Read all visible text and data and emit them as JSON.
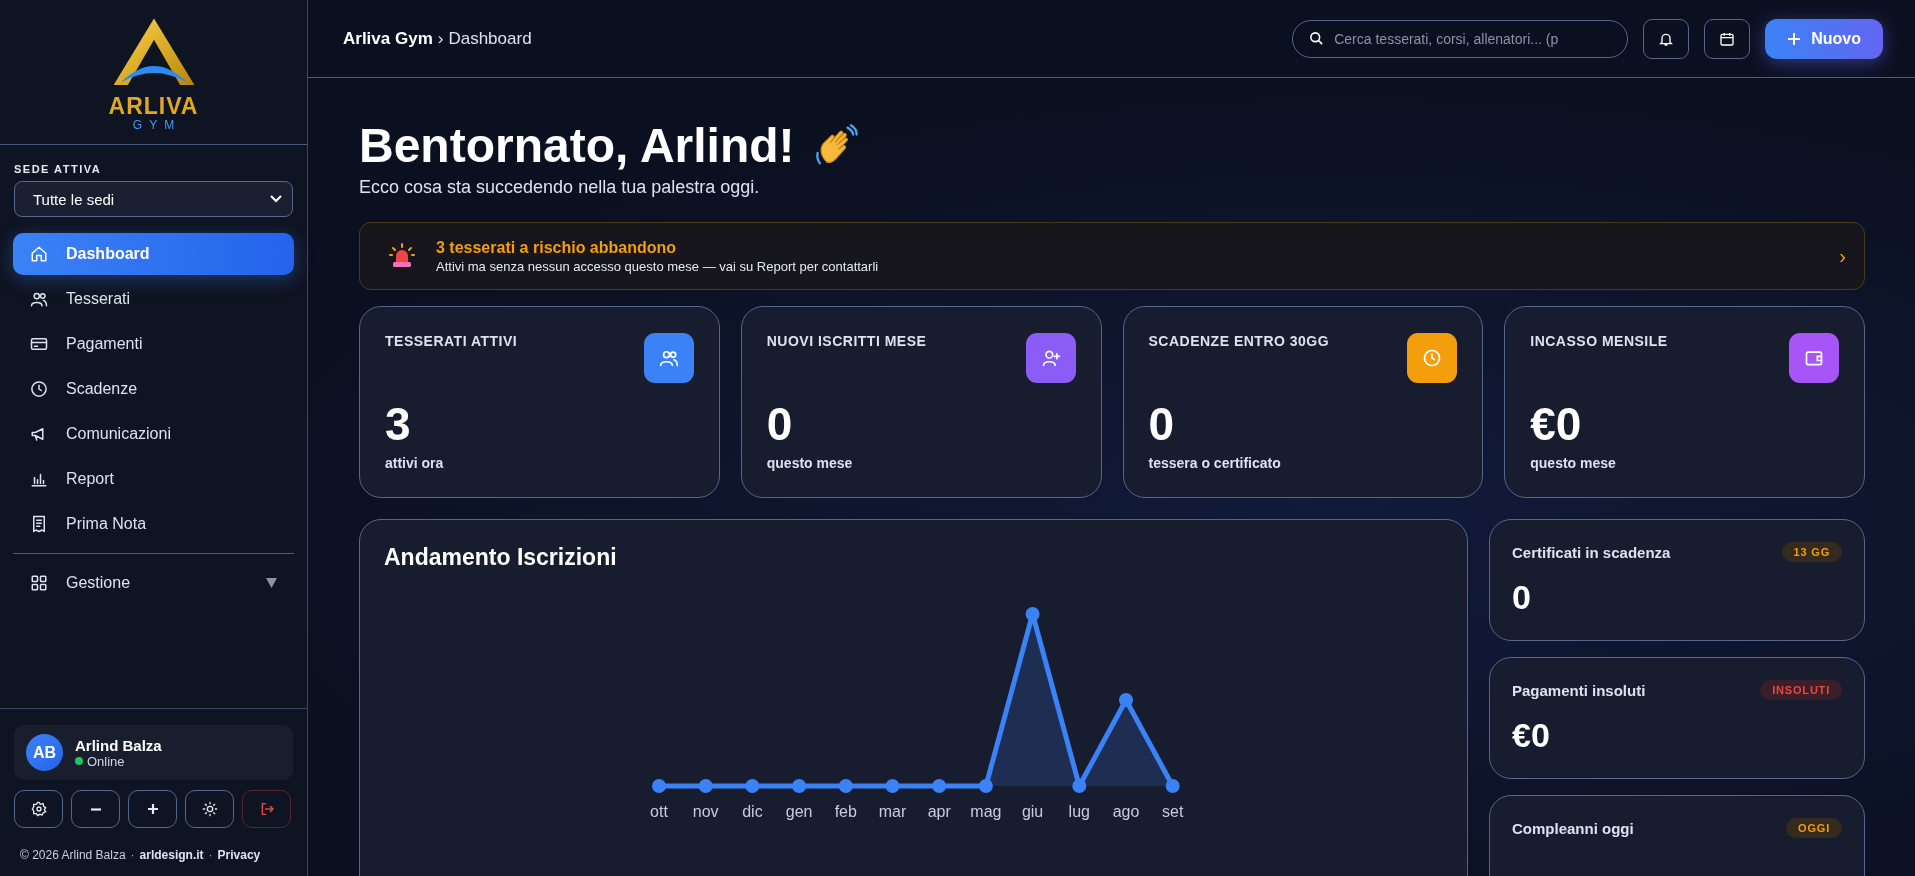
{
  "header": {
    "breadcrumb_root": "Arliva Gym",
    "breadcrumb_separator": "›",
    "breadcrumb_current": "Dashboard",
    "search": {
      "placeholder": "Cerca tesserati, corsi, allenatori... (p"
    },
    "new_button": {
      "label": "Nuovo"
    }
  },
  "sidebar": {
    "logo": {
      "name": "ARLIVA",
      "sub": "GYM"
    },
    "site_label": "SEDE ATTIVA",
    "site_select": {
      "value": "Tutte le sedi"
    },
    "nav": [
      {
        "label": "Dashboard",
        "selected": true
      },
      {
        "label": "Tesserati",
        "selected": false
      },
      {
        "label": "Pagamenti",
        "selected": false
      },
      {
        "label": "Scadenze",
        "selected": false
      },
      {
        "label": "Comunicazioni",
        "selected": false
      },
      {
        "label": "Report",
        "selected": false
      },
      {
        "label": "Prima Nota",
        "selected": false
      }
    ],
    "group": {
      "label": "Gestione",
      "expanded": false
    },
    "user": {
      "initials": "AB",
      "name": "Arlind Balza",
      "status": "Online",
      "online": true
    },
    "footer": {
      "copyright": "© 2026 Arlind Balza",
      "separator": "·",
      "link": "arldesign.it",
      "separator_2": "·",
      "privacy": "Privacy"
    }
  },
  "welcome": {
    "title": "Bentornato, Arlind!",
    "subtitle": "Ecco cosa sta succedendo nella tua palestra oggi."
  },
  "alert": {
    "title": "3 tesserati a rischio abbandono",
    "text": "Attivi ma senza nessun accesso questo mese — vai su Report per contattarli",
    "chevron": "›"
  },
  "stats": [
    {
      "label": "TESSERATI ATTIVI",
      "value": "3",
      "caption": "attivi ora",
      "color": "#3b82f6"
    },
    {
      "label": "NUOVI ISCRITTI MESE",
      "value": "0",
      "caption": "questo mese",
      "color": "#8b5cf6"
    },
    {
      "label": "SCADENZE ENTRO 30GG",
      "value": "0",
      "caption": "tessera o certificato",
      "color": "#f59e0b"
    },
    {
      "label": "INCASSO MENSILE",
      "value": "€0",
      "caption": "questo mese",
      "color": "#a855f7"
    }
  ],
  "chart": {
    "title": "Andamento Iscrizioni",
    "months": [
      "ott",
      "nov",
      "dic",
      "gen",
      "feb",
      "mar",
      "apr",
      "mag",
      "giu",
      "lug",
      "ago",
      "set"
    ]
  },
  "side_cards": [
    {
      "title": "Certificati in scadenza",
      "badge": "13 GG",
      "kind": "warning",
      "value": "0"
    },
    {
      "title": "Pagamenti insoluti",
      "badge": "INSOLUTI",
      "kind": "danger",
      "value": "€0"
    },
    {
      "title": "Compleanni oggi",
      "badge": "OGGI",
      "kind": "warning"
    }
  ]
}
